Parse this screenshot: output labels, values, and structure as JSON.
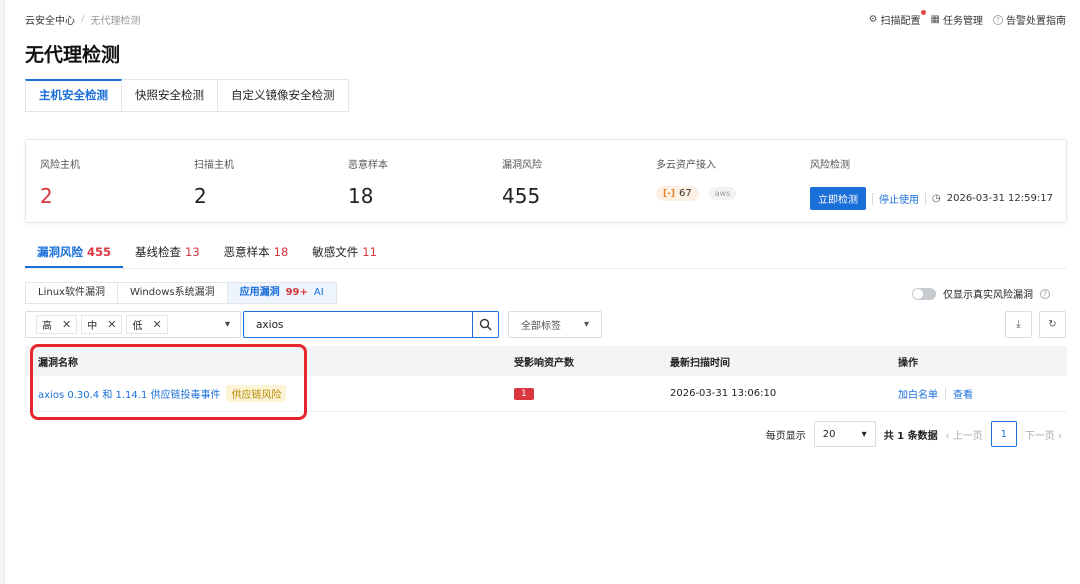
{
  "breadcrumb": {
    "parent": "云安全中心",
    "separator": "/",
    "current": "无代理检测"
  },
  "top_links": {
    "scan_config": "扫描配置",
    "task_manage": "任务管理",
    "alert_guide": "告警处置指南"
  },
  "page_title": "无代理检测",
  "main_tabs": [
    "主机安全检测",
    "快照安全检测",
    "自定义镜像安全检测"
  ],
  "summary": {
    "risk_hosts": {
      "label": "风险主机",
      "value": "2"
    },
    "scan_hosts": {
      "label": "扫描主机",
      "value": "2"
    },
    "malware": {
      "label": "恶意样本",
      "value": "18"
    },
    "vuln": {
      "label": "漏洞风险",
      "value": "455"
    },
    "multicloud": {
      "label": "多云资产接入",
      "count": "67",
      "provider_icon": "aws-icon"
    },
    "detect": {
      "label": "风险检测",
      "button": "立即检测",
      "stop": "停止使用",
      "time": "2026-03-31 12:59:17"
    }
  },
  "sub_tabs": [
    {
      "label": "漏洞风险",
      "count": "455"
    },
    {
      "label": "基线检查",
      "count": "13"
    },
    {
      "label": "恶意样本",
      "count": "18"
    },
    {
      "label": "敏感文件",
      "count": "11"
    }
  ],
  "category_tabs": {
    "linux": "Linux软件漏洞",
    "windows": "Windows系统漏洞",
    "app": "应用漏洞",
    "app_count": "99+",
    "app_ai": "AI"
  },
  "toggle_label": "仅显示真实风险漏洞",
  "filters": {
    "severity_tags": [
      "高",
      "中",
      "低"
    ],
    "search_value": "axios",
    "tag_select": "全部标签"
  },
  "table": {
    "headers": [
      "漏洞名称",
      "受影响资产数",
      "最新扫描时间",
      "操作"
    ],
    "rows": [
      {
        "name": "axios 0.30.4 和 1.14.1 供应链投毒事件",
        "tag": "供应链风险",
        "assets": "1",
        "scan_time": "2026-03-31 13:06:10",
        "action_whitelist": "加白名单",
        "action_view": "查看"
      }
    ]
  },
  "pagination": {
    "per_page_label": "每页显示",
    "per_page": "20",
    "total": "共 1 条数据",
    "prev": "上一页",
    "page": "1",
    "next": "下一页"
  },
  "colors": {
    "accent": "#1a6fd8",
    "danger": "#d9363e",
    "highlight_box": "#e5272d"
  }
}
